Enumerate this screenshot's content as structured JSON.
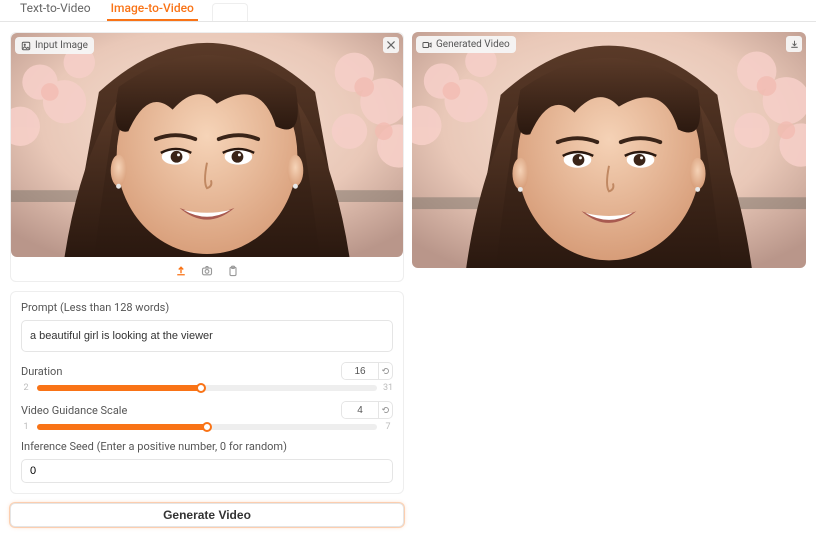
{
  "tabs": {
    "text_to_video": "Text-to-Video",
    "image_to_video": "Image-to-Video"
  },
  "input_panel": {
    "label": "Input Image"
  },
  "output_panel": {
    "label": "Generated Video"
  },
  "controls": {
    "prompt_label": "Prompt (Less than 128 words)",
    "prompt_value": "a beautiful girl is looking at the viewer",
    "duration": {
      "label": "Duration",
      "value": "16",
      "min": "2",
      "max": "31"
    },
    "guidance": {
      "label": "Video Guidance Scale",
      "value": "4",
      "min": "1",
      "max": "7"
    },
    "seed": {
      "label": "Inference Seed (Enter a positive number, 0 for random)",
      "value": "0"
    },
    "generate_label": "Generate Video"
  }
}
